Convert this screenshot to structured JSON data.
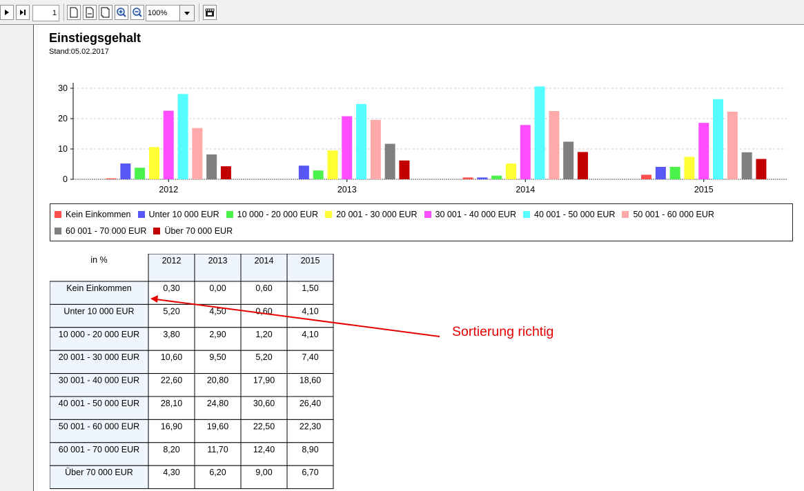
{
  "toolbar": {
    "page_number": "1",
    "zoom": "100%"
  },
  "report": {
    "title": "Einstiegsgehalt",
    "stand": "Stand:05.02.2017"
  },
  "colors": {
    "Kein Einkommen": "#ff4f4f",
    "Unter 10 000 EUR": "#5757f5",
    "10 000 - 20 000 EUR": "#4cf24c",
    "20 001 - 30 000 EUR": "#ffff33",
    "30 001 - 40 000 EUR": "#ff4dff",
    "40 001 - 50 000 EUR": "#55ffff",
    "50 001 - 60 000 EUR": "#ffaaaa",
    "60 001 - 70 000 EUR": "#808080",
    "Über 70 000 EUR": "#c30000",
    "annotation": "#e60000"
  },
  "chart_data": {
    "type": "bar",
    "title": "",
    "xlabel": "",
    "ylabel": "",
    "ylim": [
      0,
      32
    ],
    "yticks": [
      0,
      10,
      20,
      30
    ],
    "grid": true,
    "legend_placement": "bottom",
    "categories": [
      "2012",
      "2013",
      "2014",
      "2015"
    ],
    "series": [
      {
        "name": "Kein Einkommen",
        "values": [
          0.3,
          0.0,
          0.6,
          1.5
        ]
      },
      {
        "name": "Unter 10 000 EUR",
        "values": [
          5.2,
          4.5,
          0.6,
          4.1
        ]
      },
      {
        "name": "10 000 - 20 000 EUR",
        "values": [
          3.8,
          2.9,
          1.2,
          4.1
        ]
      },
      {
        "name": "20 001 - 30 000 EUR",
        "values": [
          10.6,
          9.5,
          5.2,
          7.4
        ]
      },
      {
        "name": "30 001 - 40 000 EUR",
        "values": [
          22.6,
          20.8,
          17.9,
          18.6
        ]
      },
      {
        "name": "40 001 - 50 000 EUR",
        "values": [
          28.1,
          24.8,
          30.6,
          26.4
        ]
      },
      {
        "name": "50 001 - 60 000 EUR",
        "values": [
          16.9,
          19.6,
          22.5,
          22.3
        ]
      },
      {
        "name": "60 001 - 70 000 EUR",
        "values": [
          8.2,
          11.7,
          12.4,
          8.9
        ]
      },
      {
        "name": "Über 70 000 EUR",
        "values": [
          4.3,
          6.2,
          9.0,
          6.7
        ]
      }
    ]
  },
  "table": {
    "corner_label": "in %",
    "columns": [
      "2012",
      "2013",
      "2014",
      "2015"
    ],
    "rows": [
      {
        "label": "Kein Einkommen",
        "values": [
          "0,30",
          "0,00",
          "0,60",
          "1,50"
        ]
      },
      {
        "label": "Unter 10 000 EUR",
        "values": [
          "5,20",
          "4,50",
          "0,60",
          "4,10"
        ]
      },
      {
        "label": "10 000 - 20 000 EUR",
        "values": [
          "3,80",
          "2,90",
          "1,20",
          "4,10"
        ]
      },
      {
        "label": "20 001 - 30 000 EUR",
        "values": [
          "10,60",
          "9,50",
          "5,20",
          "7,40"
        ]
      },
      {
        "label": "30 001 - 40 000 EUR",
        "values": [
          "22,60",
          "20,80",
          "17,90",
          "18,60"
        ]
      },
      {
        "label": "40 001 - 50 000 EUR",
        "values": [
          "28,10",
          "24,80",
          "30,60",
          "26,40"
        ]
      },
      {
        "label": "50 001 - 60 000 EUR",
        "values": [
          "16,90",
          "19,60",
          "22,50",
          "22,30"
        ]
      },
      {
        "label": "60 001 - 70 000 EUR",
        "values": [
          "8,20",
          "11,70",
          "12,40",
          "8,90"
        ]
      },
      {
        "label": "Über 70 000 EUR",
        "values": [
          "4,30",
          "6,20",
          "9,00",
          "6,70"
        ]
      }
    ]
  },
  "annotation": {
    "text": "Sortierung richtig"
  }
}
